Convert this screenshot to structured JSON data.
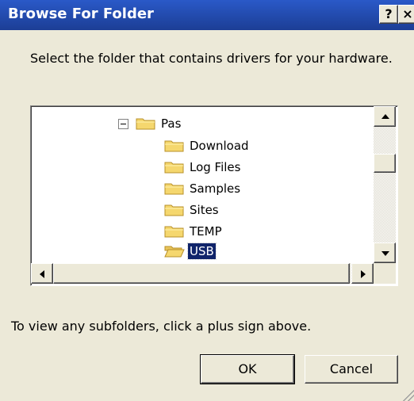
{
  "window": {
    "title": "Browse For Folder",
    "help_glyph": "?",
    "close_glyph": "×"
  },
  "instruction": "Select the folder that contains drivers for your hardware.",
  "tree": {
    "parent": {
      "label": "Pas"
    },
    "children": [
      {
        "label": "Download"
      },
      {
        "label": "Log Files"
      },
      {
        "label": "Samples"
      },
      {
        "label": "Sites"
      },
      {
        "label": "TEMP"
      },
      {
        "label": "USB",
        "selected": true
      }
    ]
  },
  "hint": "To view any subfolders, click a plus sign above.",
  "buttons": {
    "ok": "OK",
    "cancel": "Cancel"
  },
  "colors": {
    "titlebar": "#1f45a0",
    "selection": "#10246a",
    "dialog_bg": "#ece9d8",
    "folder": "#f5d76e"
  }
}
